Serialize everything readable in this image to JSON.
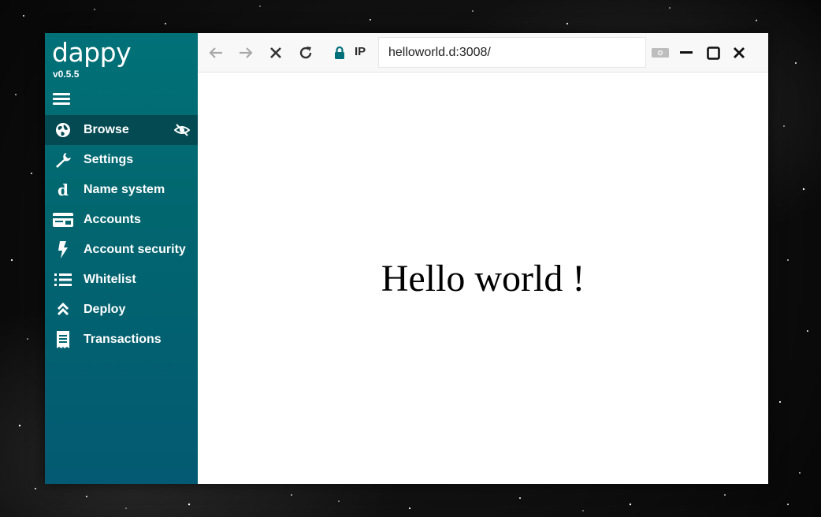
{
  "app": {
    "name": "dappy",
    "version": "v0.5.5"
  },
  "sidebar": {
    "items": [
      {
        "label": "Browse",
        "icon": "globe-icon",
        "active": true
      },
      {
        "label": "Settings",
        "icon": "wrench-icon"
      },
      {
        "label": "Name system",
        "icon": "d-letter-icon"
      },
      {
        "label": "Accounts",
        "icon": "card-icon"
      },
      {
        "label": "Account security",
        "icon": "bolt-icon"
      },
      {
        "label": "Whitelist",
        "icon": "list-icon"
      },
      {
        "label": "Deploy",
        "icon": "double-chevron-up-icon"
      },
      {
        "label": "Transactions",
        "icon": "receipt-icon"
      }
    ]
  },
  "toolbar": {
    "ip_label": "IP",
    "url": "helloworld.d:3008/"
  },
  "page": {
    "heading": "Hello world !"
  },
  "colors": {
    "sidebar": "#02666f",
    "active": "#034a52",
    "accent": "#00707a"
  }
}
